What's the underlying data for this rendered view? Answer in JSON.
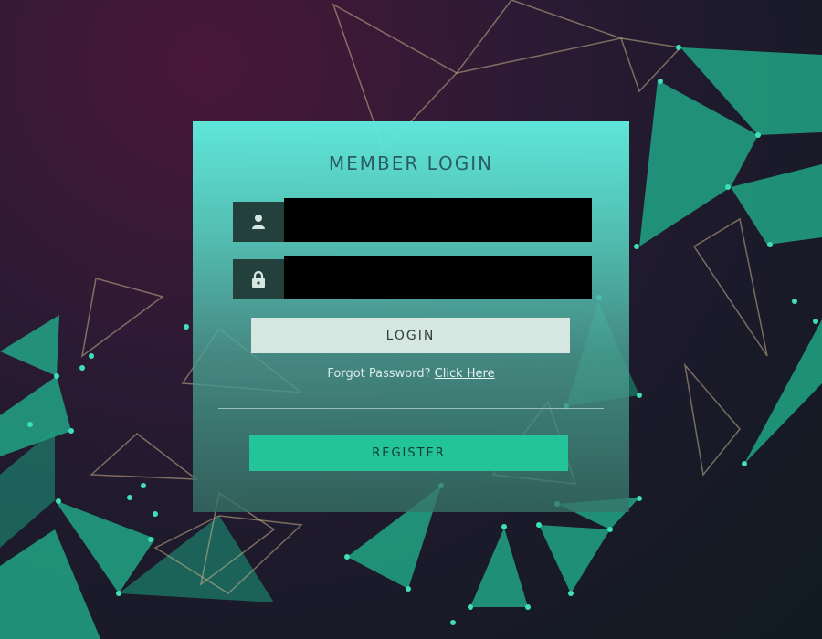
{
  "login_form": {
    "title": "MEMBER LOGIN",
    "username_icon": "user-icon",
    "username_value": "",
    "password_icon": "lock-icon",
    "password_value": "",
    "login_label": "LOGIN",
    "forgot_text": "Forgot Password?",
    "forgot_link": "Click Here",
    "register_label": "REGISTER"
  },
  "colors": {
    "card_top": "#60ECDE",
    "icon_box": "#23403D",
    "login_button": "#D6E6E0",
    "register_button": "#23C49A",
    "background": "#2D1A34"
  }
}
